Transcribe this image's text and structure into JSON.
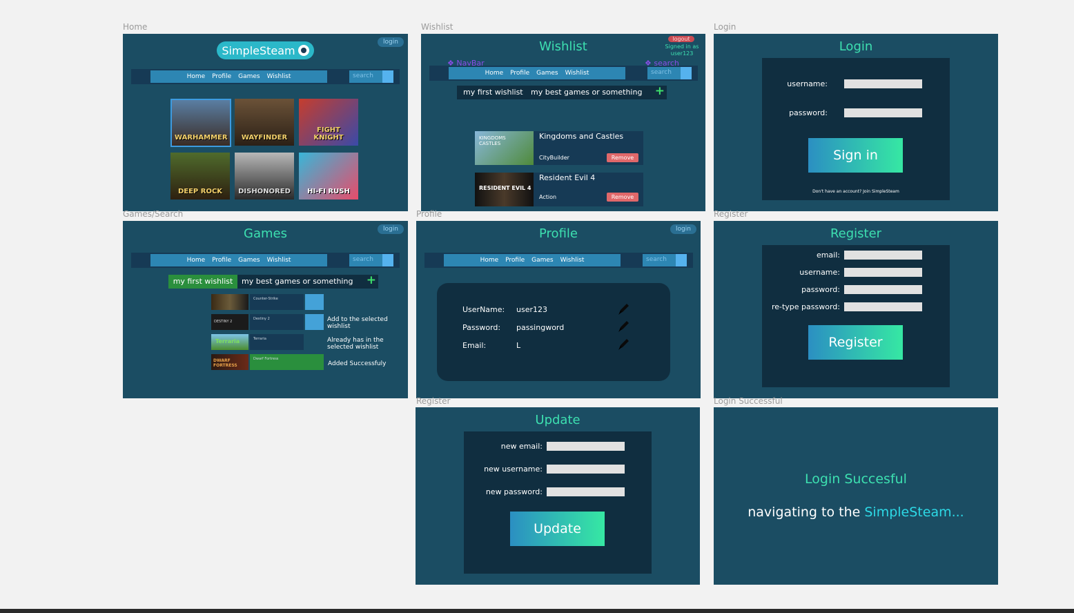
{
  "labels": {
    "home": "Home",
    "wishlist": "Wishlist",
    "login": "Login",
    "games": "Games/Search",
    "profile": "Profile",
    "register": "Register",
    "update": "Register",
    "login_success": "Login Successful"
  },
  "nav": {
    "links": [
      "Home",
      "Profile",
      "Games",
      "Wishlist"
    ],
    "search_placeholder": "search",
    "login_button": "login"
  },
  "home": {
    "logo": "SimpleSteam",
    "tiles": [
      "WARHAMMER",
      "WAYFINDER",
      "FIGHT KNIGHT",
      "DEEP ROCK",
      "DISHONORED",
      "HI-FI RUSH"
    ]
  },
  "wishlist": {
    "title": "Wishlist",
    "logout": "logout",
    "signed_in": "Signed in as",
    "signed_user": "user123",
    "annot_navbar": "NavBar",
    "annot_search": "search",
    "selected": "my first wishlist",
    "desc": "my best games or something",
    "add": "+",
    "items": [
      {
        "name": "Kingdoms and Castles",
        "genre": "CityBuilder",
        "remove": "Remove",
        "thumb": "KINGDOMS CASTLES"
      },
      {
        "name": "Resident Evil 4",
        "genre": "Action",
        "remove": "Remove",
        "thumb": "RESIDENT EVIL 4"
      }
    ]
  },
  "login": {
    "title": "Login",
    "username_label": "username:",
    "password_label": "password:",
    "button": "Sign in",
    "footer": "Don't have an account? Join SimpleSteam"
  },
  "games": {
    "title": "Games",
    "wishlist_selected": "my first wishlist",
    "wishlist_desc": "my best games or something",
    "add": "+",
    "rows": [
      {
        "name": "Counter-Strike",
        "thumb": "COUNTER-STRIKE"
      },
      {
        "name": "Destiny 2",
        "thumb": "DESTINY 2"
      },
      {
        "name": "Terraria",
        "thumb": "Terraria"
      },
      {
        "name": "Dwarf Fortress",
        "thumb": "DWARF FORTRESS"
      }
    ],
    "notes": [
      "Add to the selected wishlist",
      "Already has in the selected wishlist",
      "Added Successfuly"
    ]
  },
  "profile": {
    "title": "Profile",
    "fields": [
      {
        "label": "UserName:",
        "value": "user123"
      },
      {
        "label": "Password:",
        "value": "passingword"
      },
      {
        "label": "Email:",
        "value": "L"
      }
    ]
  },
  "register": {
    "title": "Register",
    "fields": [
      "email:",
      "username:",
      "password:",
      "re-type password:"
    ],
    "button": "Register"
  },
  "update": {
    "title": "Update",
    "fields": [
      "new email:",
      "new username:",
      "new password:"
    ],
    "button": "Update"
  },
  "success": {
    "title": "Login Succesful",
    "msg_prefix": "navigating to the ",
    "msg_brand": "SimpleSteam..."
  },
  "colors": {
    "frame": "#1b4d63",
    "accent": "#3de0b0",
    "link": "#2dd9e6",
    "remove": "#e0686a"
  }
}
